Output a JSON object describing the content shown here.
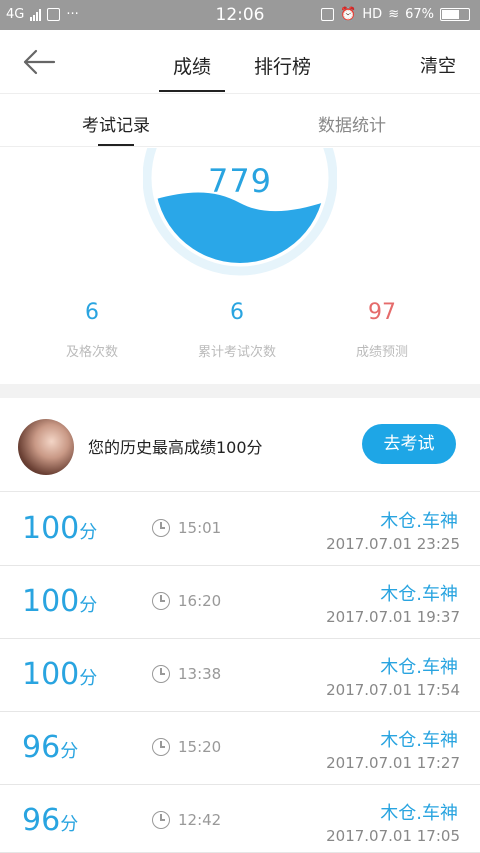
{
  "status_bar": {
    "network": "4G",
    "time": "12:06",
    "hd": "HD",
    "battery": "67%"
  },
  "header": {
    "tabs": [
      {
        "label": "成绩",
        "active": true
      },
      {
        "label": "排行榜",
        "active": false
      }
    ],
    "clear_label": "清空"
  },
  "sub_tabs": [
    {
      "label": "考试记录",
      "active": true
    },
    {
      "label": "数据统计",
      "active": false
    }
  ],
  "gauge": {
    "score": "779",
    "accent": "#29a4e0"
  },
  "stats": [
    {
      "value": "6",
      "label": "及格次数",
      "color": "#29a4e0"
    },
    {
      "value": "6",
      "label": "累计考试次数",
      "color": "#29a4e0"
    },
    {
      "value": "97",
      "label": "成绩预测",
      "color": "#e56b6b"
    }
  ],
  "best": {
    "text": "您的历史最高成绩100分",
    "button": "去考试"
  },
  "records": [
    {
      "score": "100",
      "unit": "分",
      "duration": "15:01",
      "name": "木仓.车神",
      "date": "2017.07.01  23:25"
    },
    {
      "score": "100",
      "unit": "分",
      "duration": "16:20",
      "name": "木仓.车神",
      "date": "2017.07.01  19:37"
    },
    {
      "score": "100",
      "unit": "分",
      "duration": "13:38",
      "name": "木仓.车神",
      "date": "2017.07.01  17:54"
    },
    {
      "score": "96",
      "unit": "分",
      "duration": "15:20",
      "name": "木仓.车神",
      "date": "2017.07.01  17:27"
    },
    {
      "score": "96",
      "unit": "分",
      "duration": "12:42",
      "name": "木仓.车神",
      "date": "2017.07.01  17:05"
    }
  ]
}
